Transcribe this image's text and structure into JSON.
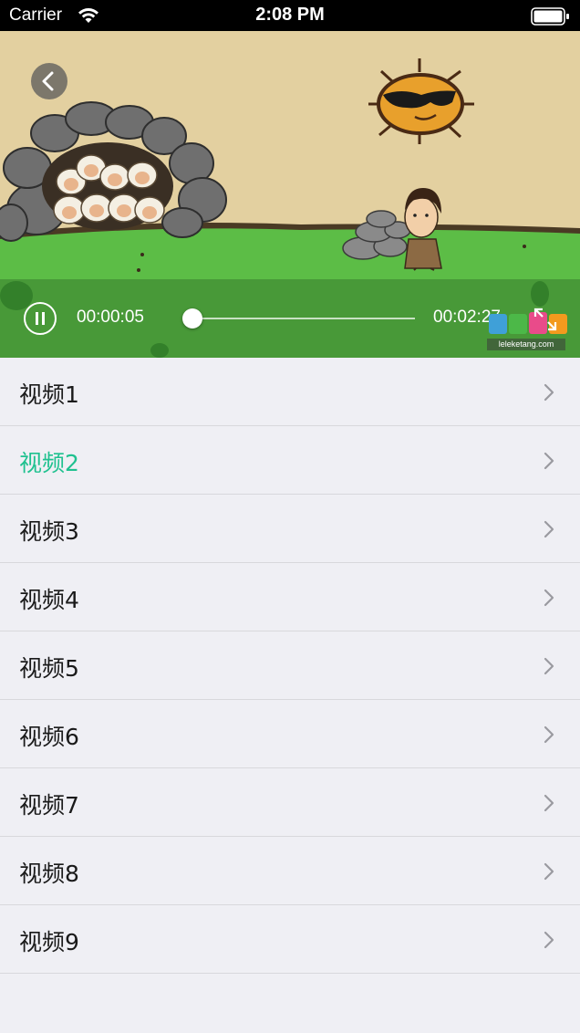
{
  "status_bar": {
    "carrier": "Carrier",
    "time": "2:08 PM"
  },
  "player": {
    "current_time": "00:00:05",
    "total_time": "00:02:27",
    "progress": 0.034,
    "watermark_url": "leleketang.com",
    "watermark_logo": "乐乐课堂",
    "accent_color": "#2bc29c"
  },
  "videos": [
    {
      "label": "视频1",
      "active": false
    },
    {
      "label": "视频2",
      "active": true
    },
    {
      "label": "视频3",
      "active": false
    },
    {
      "label": "视频4",
      "active": false
    },
    {
      "label": "视频5",
      "active": false
    },
    {
      "label": "视频6",
      "active": false
    },
    {
      "label": "视频7",
      "active": false
    },
    {
      "label": "视频8",
      "active": false
    },
    {
      "label": "视频9",
      "active": false
    }
  ],
  "colors": {
    "active_item": "#1fc18f",
    "list_background": "#efeff4"
  },
  "icons": [
    "wifi-icon",
    "battery-icon",
    "back-arrow-icon",
    "pause-icon",
    "fullscreen-icon",
    "chevron-right-icon"
  ]
}
